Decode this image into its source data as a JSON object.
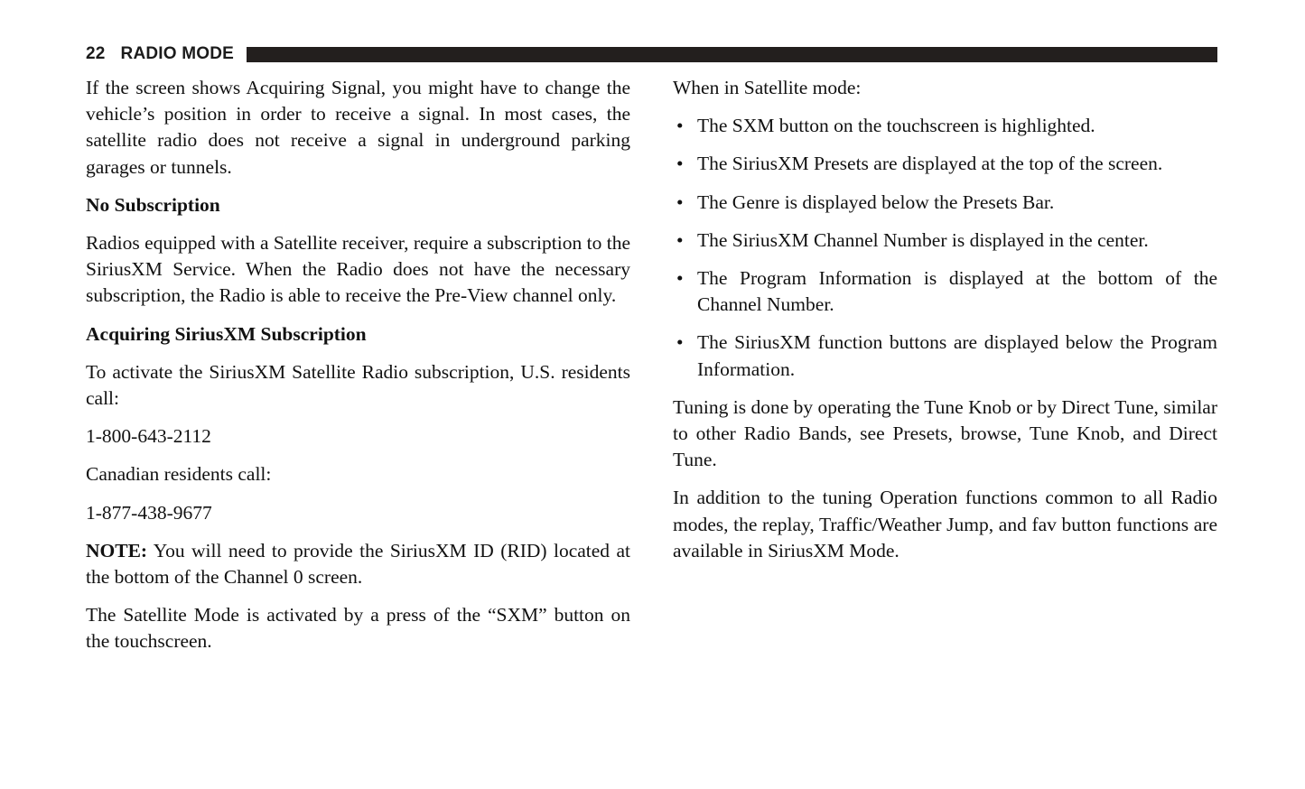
{
  "header": {
    "page_number": "22",
    "title": "RADIO MODE",
    "rule_color": "#231f1e"
  },
  "left_column": {
    "blocks": [
      {
        "kind": "paragraph",
        "name": "paragraph-acquiring-signal",
        "text": "If the screen shows Acquiring Signal, you might have to change the vehicle’s position in order to receive a signal. In most cases, the satellite radio does not receive a signal in underground parking garages or tunnels."
      },
      {
        "kind": "heading",
        "name": "heading-no-subscription",
        "text": "No Subscription"
      },
      {
        "kind": "paragraph",
        "name": "paragraph-no-subscription",
        "text": "Radios equipped with a Satellite receiver, require a subscription to the SiriusXM Service. When the Radio does not have the necessary subscription, the Radio is able to receive the Pre-View channel only."
      },
      {
        "kind": "heading",
        "name": "heading-acquiring-subscription",
        "text": "Acquiring SiriusXM Subscription"
      },
      {
        "kind": "paragraph",
        "name": "paragraph-activate-subscription",
        "text": "To activate the SiriusXM Satellite Radio subscription, U.S. residents call:"
      },
      {
        "kind": "paragraph",
        "name": "paragraph-us-phone-number",
        "text": "1-800-643-2112"
      },
      {
        "kind": "paragraph",
        "name": "paragraph-canadian-residents",
        "text": "Canadian residents call:"
      },
      {
        "kind": "paragraph",
        "name": "paragraph-canadian-phone-number",
        "text": "1-877-438-9677"
      },
      {
        "kind": "note",
        "name": "paragraph-note-siriusxm-id",
        "label": "NOTE:",
        "text": " You will need to provide the SiriusXM ID (RID) located at the bottom of the Channel 0 screen."
      },
      {
        "kind": "paragraph",
        "name": "paragraph-satellite-mode-activation",
        "text": "The Satellite Mode is activated by a press of the “SXM” button on the touchscreen."
      }
    ]
  },
  "right_column": {
    "intro": {
      "name": "paragraph-when-in-satellite-mode",
      "text": "When in Satellite mode:"
    },
    "bullet_marker": "•",
    "bullets": [
      {
        "name": "bullet-sxm-button-highlighted",
        "text": "The SXM button on the touchscreen is highlighted."
      },
      {
        "name": "bullet-presets-top-of-screen",
        "text": "The SiriusXM Presets are displayed at the top of the screen."
      },
      {
        "name": "bullet-genre-below-presets-bar",
        "text": "The Genre is displayed below the Presets Bar."
      },
      {
        "name": "bullet-channel-number-center",
        "text": "The SiriusXM Channel Number is displayed in the center."
      },
      {
        "name": "bullet-program-information-bottom",
        "text": "The Program Information is displayed at the bottom of the Channel Number."
      },
      {
        "name": "bullet-function-buttons-below",
        "text": "The SiriusXM function buttons are displayed below the Program Information."
      }
    ],
    "closing_paragraphs": [
      {
        "name": "paragraph-tuning-tune-knob",
        "text": "Tuning is done by operating the Tune Knob or by Direct Tune, similar to other Radio Bands, see Presets, browse, Tune Knob, and Direct Tune."
      },
      {
        "name": "paragraph-additional-functions",
        "text": "In addition to the tuning Operation functions common to all Radio modes, the replay, Traffic/Weather Jump, and fav button functions are available in SiriusXM Mode."
      }
    ]
  }
}
